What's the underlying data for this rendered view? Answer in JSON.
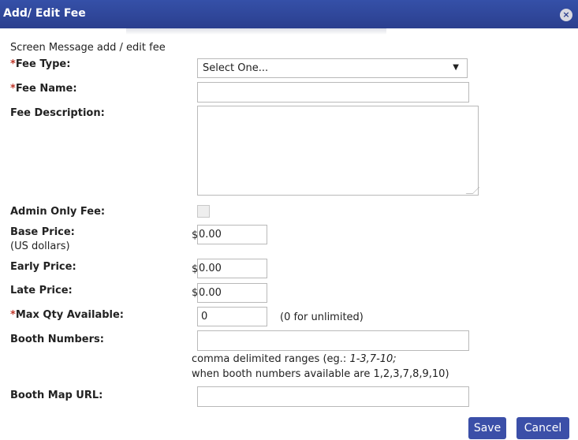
{
  "dialog": {
    "title": "Add/ Edit Fee",
    "close_icon": "×"
  },
  "screen_message": "Screen Message add / edit fee",
  "required_marker": "*",
  "fields": {
    "fee_type": {
      "label": "Fee Type:",
      "value": "Select One...",
      "arrow": "▼"
    },
    "fee_name": {
      "label": "Fee Name:",
      "value": ""
    },
    "fee_description": {
      "label": "Fee Description:",
      "value": ""
    },
    "admin_only": {
      "label": "Admin Only Fee:",
      "checked": false
    },
    "base_price": {
      "label": "Base Price:",
      "sublabel": "(US dollars)",
      "currency": "$",
      "value": "0.00"
    },
    "early_price": {
      "label": "Early Price:",
      "currency": "$",
      "value": "0.00"
    },
    "late_price": {
      "label": "Late Price:",
      "currency": "$",
      "value": "0.00"
    },
    "max_qty": {
      "label": "Max Qty Available:",
      "value": "0",
      "hint": "(0 for unlimited)"
    },
    "booth_numbers": {
      "label": "Booth Numbers:",
      "value": "",
      "hint_prefix": "comma delimited ranges (eg.: ",
      "hint_example": "1-3,7-10;",
      "hint_line2": "when booth numbers available are 1,2,3,7,8,9,10)"
    },
    "booth_map_url": {
      "label": "Booth Map URL:",
      "value": ""
    }
  },
  "buttons": {
    "save": "Save",
    "cancel": "Cancel"
  }
}
